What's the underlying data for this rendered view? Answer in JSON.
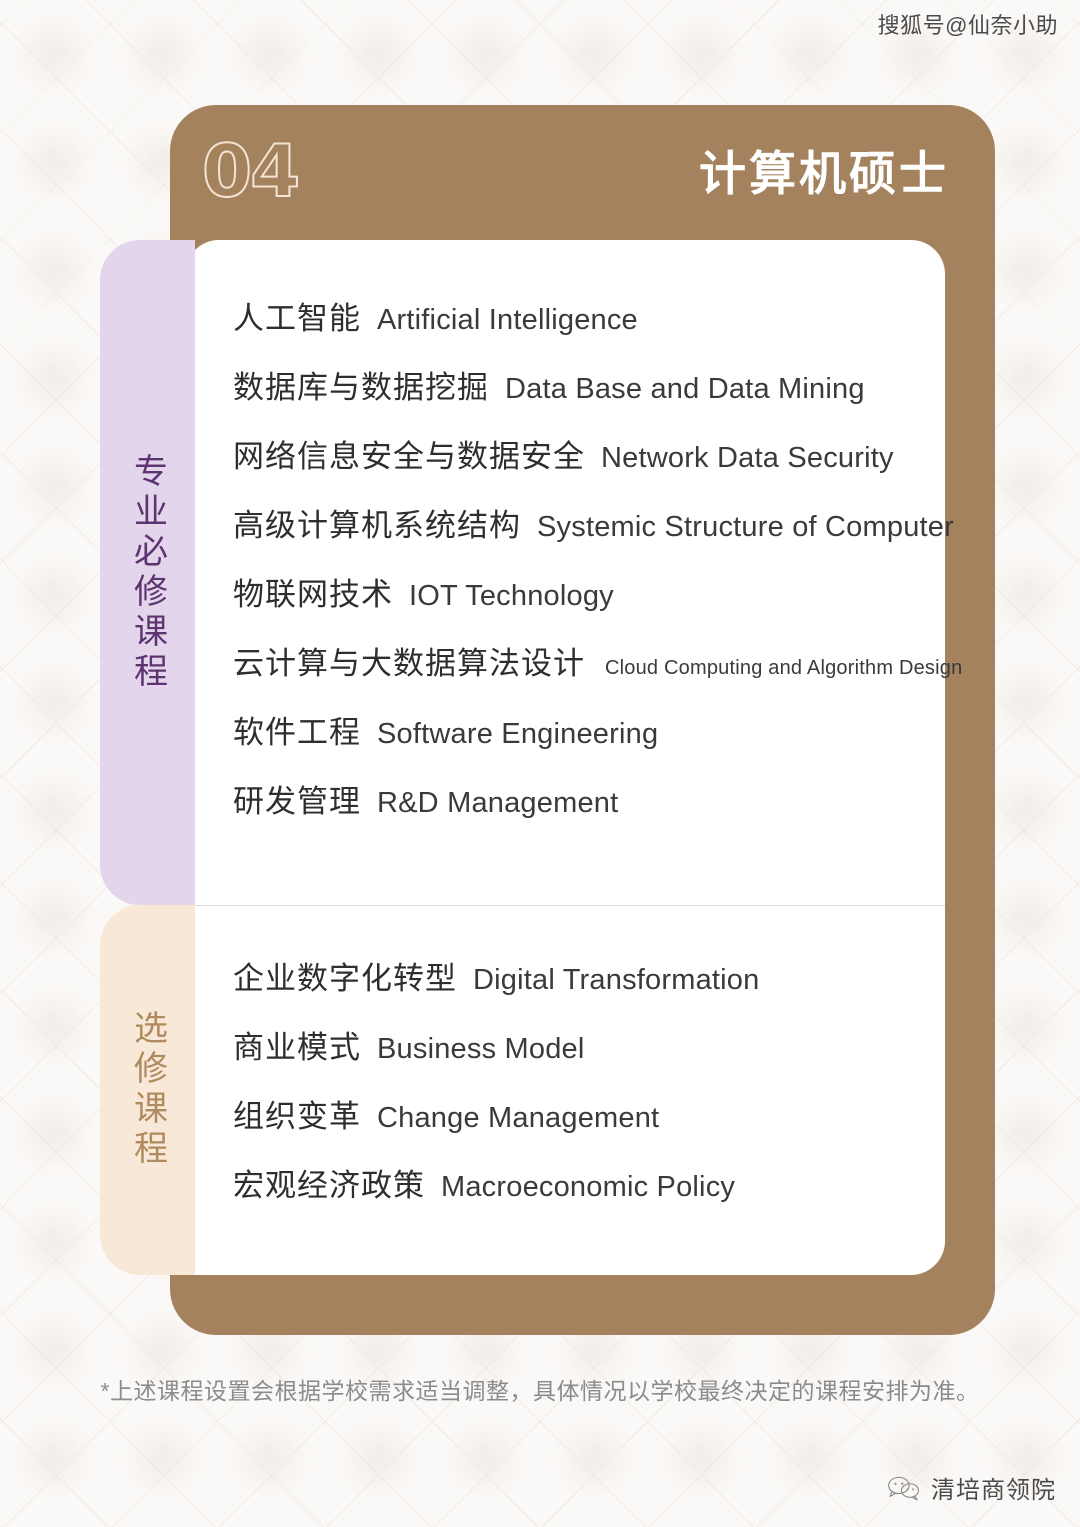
{
  "watermark": {
    "top_right": "搜狐号@仙奈小助"
  },
  "header": {
    "number": "04",
    "title": "计算机硕士"
  },
  "categories": [
    {
      "label": "专业必修课程",
      "color": "#e3d6ec",
      "text_color": "#5e3470"
    },
    {
      "label": "选修课程",
      "color": "#f8e8d7",
      "text_color": "#b08a5f"
    }
  ],
  "required_courses": [
    {
      "cn": "人工智能",
      "en": "Artificial Intelligence",
      "small": false
    },
    {
      "cn": "数据库与数据挖掘",
      "en": "Data Base and Data Mining",
      "small": false
    },
    {
      "cn": "网络信息安全与数据安全",
      "en": "Network Data Security",
      "small": false
    },
    {
      "cn": "高级计算机系统结构",
      "en": "Systemic Structure of Computer",
      "small": false
    },
    {
      "cn": "物联网技术",
      "en": "IOT Technology",
      "small": false
    },
    {
      "cn": "云计算与大数据算法设计",
      "en": "Cloud Computing and Algorithm Design",
      "small": true
    },
    {
      "cn": "软件工程",
      "en": "Software Engineering",
      "small": false
    },
    {
      "cn": "研发管理",
      "en": "R&D Management",
      "small": false
    }
  ],
  "elective_courses": [
    {
      "cn": "企业数字化转型",
      "en": "Digital Transformation",
      "small": false
    },
    {
      "cn": "商业模式",
      "en": "Business Model",
      "small": false
    },
    {
      "cn": "组织变革",
      "en": "Change Management",
      "small": false
    },
    {
      "cn": "宏观经济政策",
      "en": "Macroeconomic Policy",
      "small": false
    }
  ],
  "footer": {
    "note": "*上述课程设置会根据学校需求适当调整，具体情况以学校最终决定的课程安排为准。",
    "brand_name": "清培商领院"
  },
  "colors": {
    "card_brown": "#a5825e",
    "page_background": "#fbf9f7",
    "content_white": "#ffffff"
  }
}
